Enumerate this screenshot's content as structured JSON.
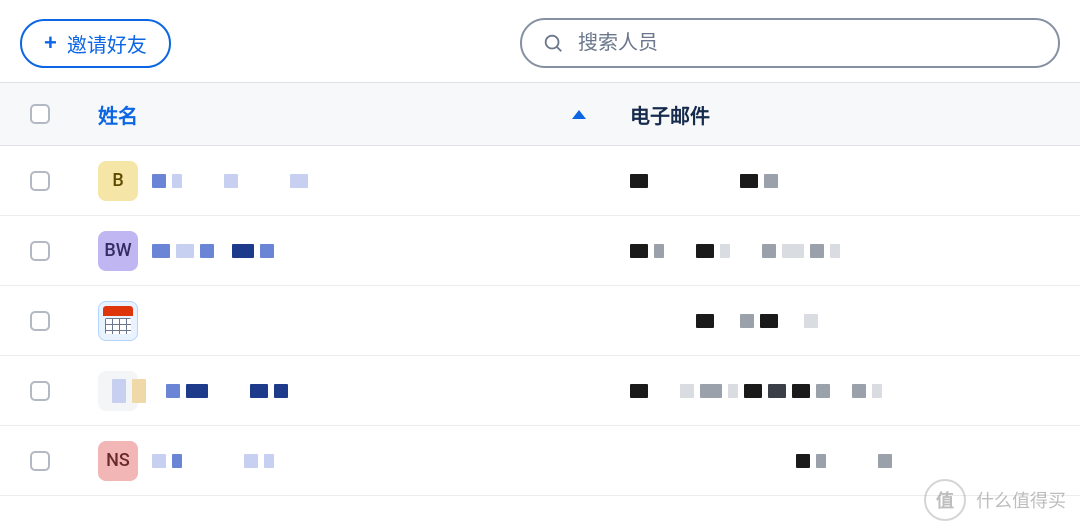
{
  "toolbar": {
    "invite_label": "邀请好友"
  },
  "search": {
    "placeholder": "搜索人员",
    "value": ""
  },
  "columns": {
    "name": "姓名",
    "email": "电子邮件"
  },
  "rows": [
    {
      "avatar_text": "B",
      "avatar_variant": "b",
      "name_redacted": true,
      "email_redacted": true
    },
    {
      "avatar_text": "BW",
      "avatar_variant": "bw",
      "name_redacted": true,
      "email_redacted": true
    },
    {
      "avatar_text": "",
      "avatar_variant": "cal",
      "name_redacted": true,
      "email_redacted": true
    },
    {
      "avatar_text": "",
      "avatar_variant": "blank",
      "name_redacted": true,
      "email_redacted": true
    },
    {
      "avatar_text": "NS",
      "avatar_variant": "ns",
      "name_redacted": true,
      "email_redacted": true
    }
  ],
  "watermark": {
    "badge": "值",
    "text": "什么值得买"
  }
}
